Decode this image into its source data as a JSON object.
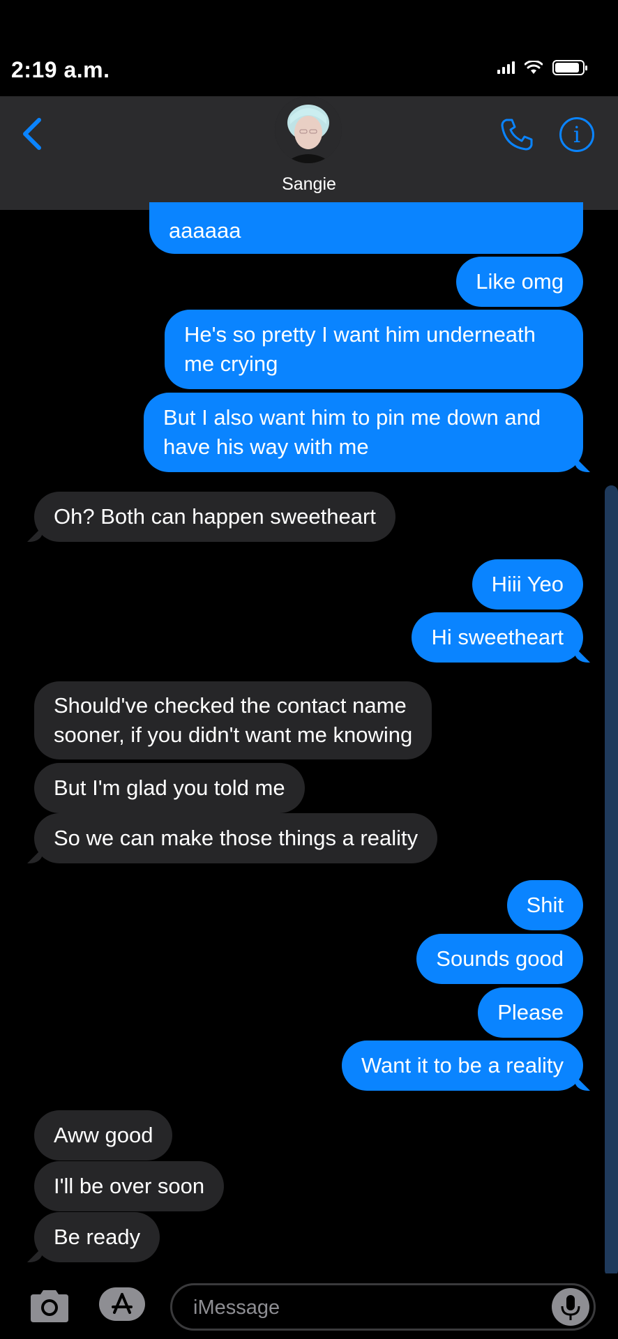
{
  "status_bar": {
    "time": "2:19 a.m."
  },
  "header": {
    "contact_name": "Sangie"
  },
  "messages": [
    {
      "side": "sent",
      "text": "aaaaaa"
    },
    {
      "side": "sent",
      "text": "Like omg"
    },
    {
      "side": "sent",
      "lines": [
        "He's so pretty I want him underneath",
        "me crying"
      ]
    },
    {
      "side": "sent",
      "lines": [
        "But I also want him to pin me down and",
        "have his way with me"
      ]
    },
    {
      "side": "received",
      "text": "Oh? Both can happen sweetheart"
    },
    {
      "side": "sent",
      "text": "Hiii Yeo"
    },
    {
      "side": "sent",
      "text": "Hi sweetheart"
    },
    {
      "side": "received",
      "lines": [
        "Should've checked the contact name",
        "sooner, if you didn't want me knowing"
      ]
    },
    {
      "side": "received",
      "text": "But I'm glad you told me"
    },
    {
      "side": "received",
      "text": "So we can make those things a reality"
    },
    {
      "side": "sent",
      "text": "Shit"
    },
    {
      "side": "sent",
      "text": "Sounds good"
    },
    {
      "side": "sent",
      "text": "Please"
    },
    {
      "side": "sent",
      "text": "Want it to be a reality"
    },
    {
      "side": "received",
      "text": "Aww good"
    },
    {
      "side": "received",
      "text": "I'll be over soon"
    },
    {
      "side": "received",
      "text": "Be ready"
    }
  ],
  "input": {
    "placeholder": "iMessage"
  },
  "colors": {
    "accent": "#0a84ff",
    "received_bubble": "#262628",
    "header_bg": "#2b2b2d",
    "background": "#000000"
  }
}
